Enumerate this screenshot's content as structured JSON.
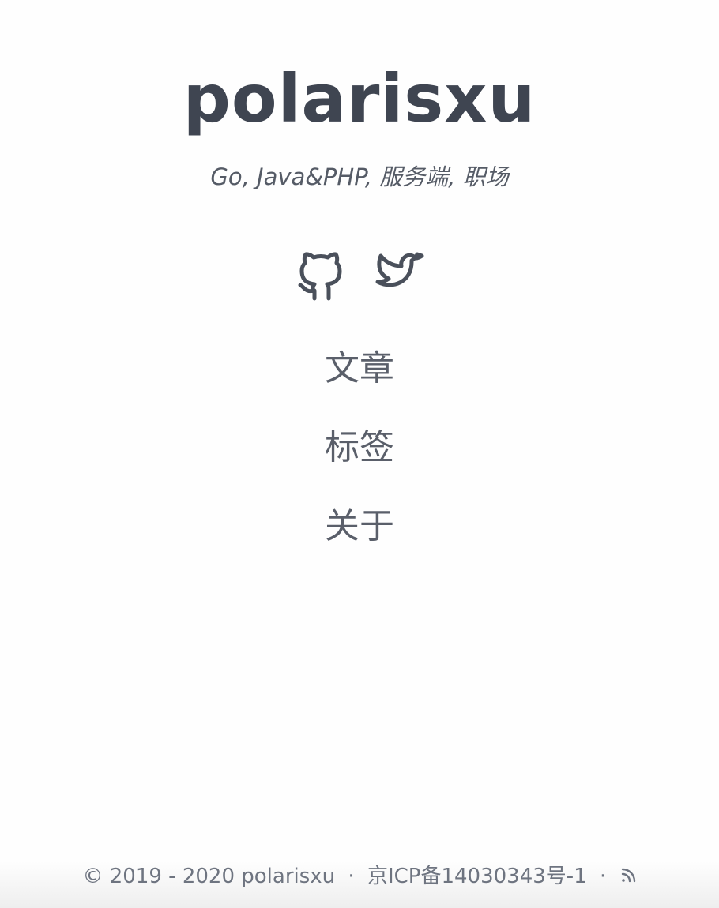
{
  "site": {
    "title": "polarisxu",
    "subtitle": "Go, Java&PHP, 服务端, 职场"
  },
  "social": [
    {
      "icon": "github-icon"
    },
    {
      "icon": "twitter-icon"
    }
  ],
  "nav": [
    {
      "label": "文章"
    },
    {
      "label": "标签"
    },
    {
      "label": "关于"
    }
  ],
  "footer": {
    "copyright": "© 2019 - 2020 polarisxu",
    "separator": "·",
    "icp": "京ICP备14030343号-1",
    "rss_icon": "rss-icon"
  },
  "colors": {
    "background": "#fefefe",
    "text": "#3f4551",
    "muted": "#6e7480"
  }
}
